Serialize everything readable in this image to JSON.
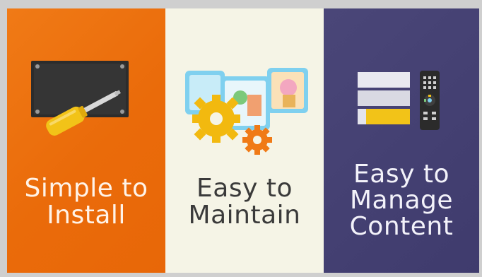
{
  "panels": [
    {
      "id": "install",
      "line1": "Simple to",
      "line2": "Install",
      "color": "#ee7312",
      "icon": "screwdriver-screen-icon"
    },
    {
      "id": "maintain",
      "line1": "Easy to",
      "line2": "Maintain",
      "color": "#f5f4e6",
      "icon": "gears-photos-icon"
    },
    {
      "id": "manage",
      "line1": "Easy to",
      "line2": "Manage",
      "line3": "Content",
      "color": "#443f73",
      "icon": "playlist-remote-icon"
    }
  ]
}
